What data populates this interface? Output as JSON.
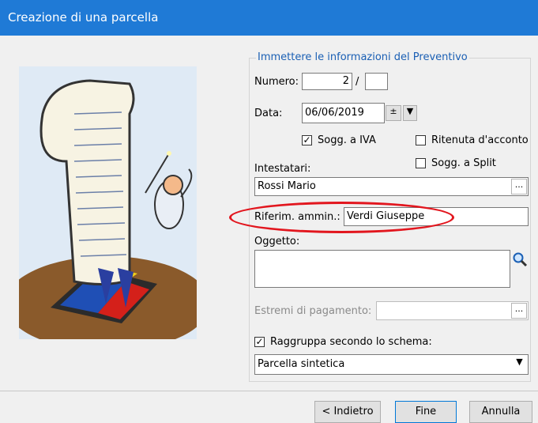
{
  "window": {
    "title": "Creazione di una parcella"
  },
  "group": {
    "legend": "Immettere le informazioni del Preventivo"
  },
  "numero": {
    "label": "Numero:",
    "value": "2",
    "separator": "/",
    "suffix": ""
  },
  "data": {
    "label": "Data:",
    "value": "06/06/2019"
  },
  "sogg_iva": {
    "label": "Sogg. a IVA",
    "checked": true
  },
  "ritenuta": {
    "label": "Ritenuta d'acconto",
    "checked": false
  },
  "sogg_split": {
    "label": "Sogg. a Split",
    "checked": false
  },
  "intestatari": {
    "label": "Intestatari:",
    "value": "Rossi Mario",
    "button": "..."
  },
  "riferim": {
    "label": "Riferim. ammin.:",
    "value": "Verdi Giuseppe"
  },
  "oggetto": {
    "label": "Oggetto:",
    "value": ""
  },
  "estremi": {
    "label": "Estremi di pagamento:",
    "value": "",
    "button": "..."
  },
  "raggruppa": {
    "label": "Raggruppa secondo lo schema:",
    "checked": true
  },
  "schema": {
    "selected": "Parcella sintetica"
  },
  "buttons": {
    "back": "< Indietro",
    "finish": "Fine",
    "cancel": "Annulla"
  },
  "colors": {
    "titlebar": "#1f7ad6",
    "legend": "#1a5fb4",
    "highlight": "#e2161e"
  },
  "icons": {
    "search": "search-icon",
    "dropdown": "chevron-down-icon",
    "spin": "spin-icon"
  }
}
